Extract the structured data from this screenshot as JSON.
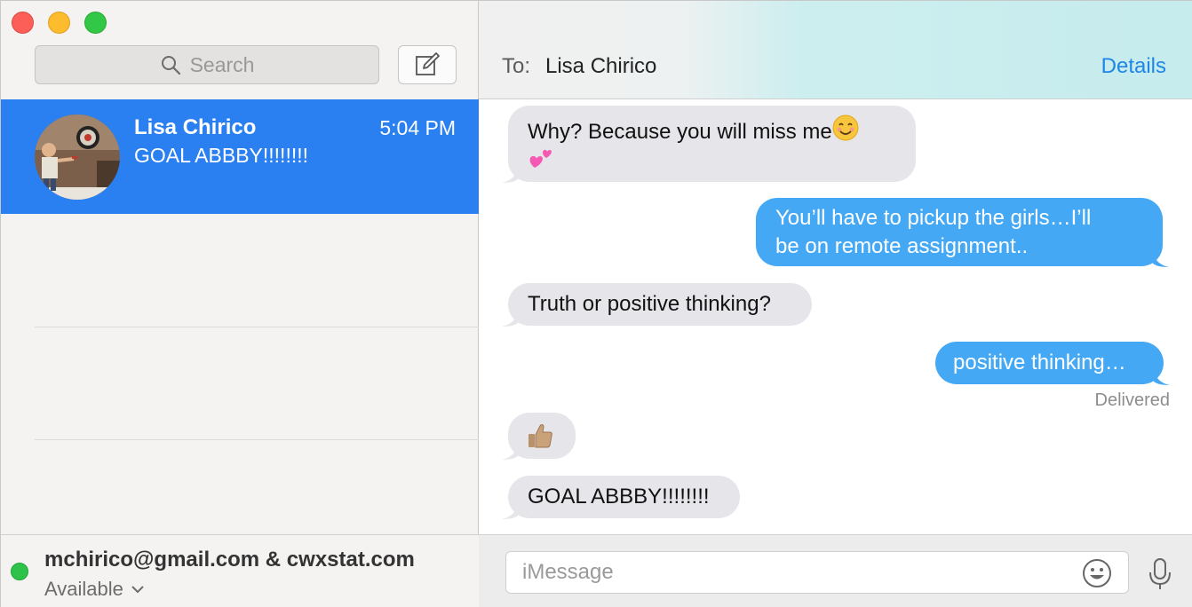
{
  "sidebar": {
    "search_placeholder": "Search",
    "conversations": [
      {
        "name": "Lisa Chirico",
        "time": "5:04 PM",
        "preview": "GOAL ABBBY!!!!!!!!"
      }
    ],
    "account": {
      "name": "mchirico@gmail.com & cwxstat.com",
      "status": "Available"
    }
  },
  "header": {
    "to_label": "To:",
    "recipient": "Lisa Chirico",
    "details": "Details"
  },
  "messages": [
    {
      "dir": "in",
      "text": "Why? Because you will miss me",
      "emoji": [
        "smiling-face-emoji",
        "two-hearts-emoji"
      ]
    },
    {
      "dir": "out",
      "text": "You’ll have to pickup the girls…I’ll",
      "text2": "be on remote assignment.."
    },
    {
      "dir": "in",
      "text": "Truth or positive thinking?"
    },
    {
      "dir": "out",
      "text": "positive thinking…"
    },
    {
      "dir": "in",
      "emoji": [
        "thumbs-up-emoji"
      ]
    },
    {
      "dir": "in",
      "text": "GOAL ABBBY!!!!!!!!"
    }
  ],
  "delivered": "Delivered",
  "composer": {
    "placeholder": "iMessage"
  },
  "colors": {
    "selection": "#2a7ff1",
    "outgoing": "#45a8f4",
    "incoming": "#e6e6ea",
    "link": "#1f86e6",
    "status_available": "#2dc34a"
  }
}
